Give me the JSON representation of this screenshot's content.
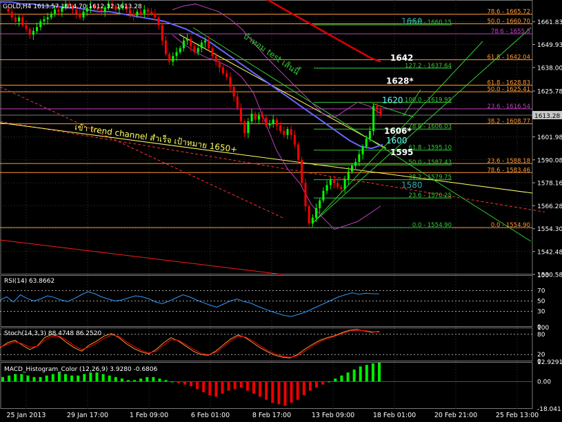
{
  "colors": {
    "background": "#000000",
    "grid": "#3a3a3a",
    "bull_candle": "#00ff00",
    "bear_candle": "#ff0000",
    "price_tag": "#c8c8c8",
    "fib_orange": "#ff9933",
    "fib_violet": "#c040c0",
    "fib_green": "#33cc33",
    "annotation_text": "#ffff66",
    "target_cyan": "#66ffff",
    "ma_fast": "#6666ff",
    "ma_slow": "#dd0000",
    "rsi_line": "#3399ff",
    "stoch_main": "#ff9933",
    "stoch_signal": "#ff0000",
    "macd_pos": "#00ee00",
    "macd_neg": "#ee0000"
  },
  "chart_data": [
    {
      "type": "candlestick",
      "title": "GOLD,H4  1613.57 1614.70 1612.32 1613.28",
      "ylim": [
        1530.58,
        1673.04
      ],
      "yticks": [
        "1661.83",
        "1649.93",
        "1638.00",
        "1625.78",
        "1613.28",
        "1601.98",
        "1590.08",
        "1578.16",
        "1566.28",
        "1554.30",
        "1542.48",
        "1530.58"
      ],
      "current_price": "1613.28",
      "xticks": [
        "25 Jan 2013",
        "29 Jan 17:00",
        "1 Feb 09:00",
        "6 Feb 01:00",
        "8 Feb 17:00",
        "13 Feb 09:00",
        "18 Feb 01:00",
        "20 Feb 21:00",
        "25 Feb 13:00"
      ],
      "fib_levels_right": [
        {
          "label": "78.6 - 1665.72",
          "value": 1665.72,
          "color": "orange"
        },
        {
          "label": "50.0 - 1660.70",
          "value": 1660.7,
          "color": "orange"
        },
        {
          "label": "78.6 - 1655.5",
          "value": 1655.5,
          "color": "violet"
        },
        {
          "label": "61.8 - 1642.04",
          "value": 1642.04,
          "color": "orange"
        },
        {
          "label": "61.8 - 1628.83",
          "value": 1628.83,
          "color": "orange"
        },
        {
          "label": "50.0 - 1625.41",
          "value": 1625.41,
          "color": "orange"
        },
        {
          "label": "23.6 - 1616.54",
          "value": 1616.54,
          "color": "violet"
        },
        {
          "label": "38.2 - 1608.77",
          "value": 1608.77,
          "color": "orange"
        },
        {
          "label": "23.6 - 1588.18",
          "value": 1588.18,
          "color": "orange"
        },
        {
          "label": "78.6 - 1583.46",
          "value": 1583.46,
          "color": "orange"
        },
        {
          "label": "0.0 - 1554.90",
          "value": 1554.9,
          "color": "orange"
        }
      ],
      "fib_levels_mid": [
        {
          "label": "23.6 - 1660.15",
          "value": 1660.15
        },
        {
          "label": "127.2 - 1637.64",
          "value": 1637.64
        },
        {
          "label": "100.0 - 1619.95",
          "value": 1619.95
        },
        {
          "label": "78.6 - 1606.03",
          "value": 1606.03
        },
        {
          "label": "61.8 - 1595.10",
          "value": 1595.1
        },
        {
          "label": "50.0 - 1587.43",
          "value": 1587.43
        },
        {
          "label": "38.2 - 1579.75",
          "value": 1579.75
        },
        {
          "label": "23.6 - 1570.25",
          "value": 1570.25
        },
        {
          "label": "0.0 - 1554.90",
          "value": 1554.9
        }
      ],
      "target_labels": [
        {
          "text": "1660",
          "value": 1662
        },
        {
          "text": "1642",
          "value": 1643
        },
        {
          "text": "1628*",
          "value": 1631
        },
        {
          "text": "1620",
          "value": 1621
        },
        {
          "text": "1606*",
          "value": 1605
        },
        {
          "text": "1600",
          "value": 1600
        },
        {
          "text": "1595",
          "value": 1594
        },
        {
          "text": "1580",
          "value": 1577
        }
      ],
      "annotations": [
        "บ้าทอม test เส้นนี้",
        "เข้า trend channel สำเร็จ เป้าหมาย 1650+"
      ],
      "closes": [
        1667,
        1664,
        1662,
        1664,
        1660,
        1658,
        1655,
        1657,
        1659,
        1662,
        1663,
        1664,
        1666,
        1668,
        1667,
        1669,
        1671,
        1670,
        1668,
        1666,
        1664,
        1667,
        1669,
        1670,
        1669,
        1668,
        1667,
        1669,
        1671,
        1670,
        1668,
        1669,
        1670,
        1668,
        1666,
        1665,
        1667,
        1666,
        1668,
        1667,
        1666,
        1664,
        1660,
        1652,
        1645,
        1641,
        1644,
        1646,
        1648,
        1652,
        1653,
        1649,
        1646,
        1648,
        1651,
        1652,
        1648,
        1644,
        1641,
        1638,
        1635,
        1633,
        1628,
        1623,
        1617,
        1610,
        1604,
        1610,
        1614,
        1611,
        1613,
        1612,
        1608,
        1609,
        1611,
        1608,
        1605,
        1603,
        1606,
        1603,
        1598,
        1590,
        1578,
        1566,
        1557,
        1560,
        1565,
        1569,
        1574,
        1577,
        1580,
        1578,
        1576,
        1575,
        1580,
        1584,
        1587,
        1589,
        1593,
        1597,
        1601,
        1605,
        1618,
        1616,
        1613
      ],
      "ma_fast": [
        1672,
        1672,
        1671,
        1671,
        1670,
        1670,
        1669,
        1669,
        1668,
        1667,
        1667,
        1666,
        1665,
        1664,
        1663,
        1662,
        1660,
        1658,
        1655,
        1652,
        1648,
        1644,
        1640,
        1636,
        1632,
        1628,
        1624,
        1620,
        1616,
        1612,
        1608,
        1604,
        1600,
        1597,
        1596,
        1598
      ],
      "ma_slow": [
        1690,
        1689,
        1688,
        1686,
        1684,
        1682,
        1679,
        1676,
        1673,
        1670,
        1667,
        1664,
        1661,
        1658,
        1655,
        1652,
        1649,
        1646,
        1643,
        1641
      ],
      "bollinger_upper": [
        1668,
        1670,
        1671,
        1669,
        1667,
        1663,
        1658,
        1651,
        1644,
        1638,
        1632,
        1626,
        1620,
        1614,
        1612,
        1616,
        1620,
        1618,
        1614
      ],
      "bollinger_lower": [
        1655,
        1650,
        1646,
        1643,
        1641,
        1638,
        1633,
        1625,
        1610,
        1595,
        1585,
        1578,
        1567,
        1560,
        1554,
        1556,
        1558,
        1562,
        1566
      ]
    },
    {
      "type": "line",
      "title": "RSI(14) 63.8662",
      "ylim": [
        0,
        100
      ],
      "yticks": [
        "100",
        "70",
        "50",
        "30",
        "0"
      ],
      "levels": [
        70,
        50,
        30
      ],
      "values": [
        52,
        58,
        48,
        62,
        55,
        50,
        54,
        60,
        57,
        52,
        49,
        55,
        62,
        68,
        64,
        58,
        54,
        50,
        52,
        56,
        60,
        58,
        54,
        48,
        45,
        50,
        56,
        62,
        58,
        52,
        47,
        42,
        38,
        44,
        50,
        54,
        49,
        46,
        40,
        35,
        30,
        26,
        22,
        20,
        24,
        28,
        34,
        40,
        46,
        52,
        58,
        62,
        66,
        63,
        65,
        64,
        63.87
      ]
    },
    {
      "type": "line",
      "title": "Stoch(14,3,3) 88.4748 86.2520",
      "ylim": [
        0,
        100
      ],
      "yticks": [
        "100",
        "80",
        "20",
        "0"
      ],
      "levels": [
        80,
        20
      ],
      "series": [
        {
          "name": "main",
          "values": [
            40,
            55,
            62,
            48,
            35,
            45,
            70,
            80,
            72,
            55,
            40,
            30,
            48,
            60,
            75,
            82,
            70,
            52,
            38,
            28,
            22,
            35,
            55,
            70,
            60,
            45,
            30,
            20,
            18,
            30,
            48,
            66,
            78,
            70,
            55,
            40,
            28,
            18,
            12,
            10,
            20,
            36,
            50,
            62,
            70,
            76,
            85,
            92,
            94,
            90,
            86,
            88.47
          ]
        },
        {
          "name": "signal",
          "values": [
            42,
            50,
            58,
            52,
            42,
            44,
            62,
            75,
            74,
            62,
            46,
            35,
            42,
            54,
            68,
            78,
            74,
            58,
            44,
            32,
            25,
            30,
            48,
            64,
            62,
            50,
            36,
            24,
            20,
            26,
            42,
            60,
            74,
            72,
            60,
            46,
            32,
            22,
            15,
            12,
            16,
            30,
            45,
            58,
            67,
            74,
            82,
            89,
            92,
            91,
            88,
            86.25
          ]
        }
      ]
    },
    {
      "type": "bar",
      "title": "MACD_Histogram_Color (12,26,9)  3.9280 -0.6806",
      "ylim": [
        -18.041,
        12.9291
      ],
      "yticks": [
        "12.9291",
        "0.00",
        "-18.041"
      ],
      "values": [
        3,
        4,
        5,
        5,
        4,
        3,
        3,
        4,
        5,
        6,
        5,
        4,
        4,
        5,
        6,
        6,
        5,
        4,
        3,
        2,
        1,
        1,
        2,
        3,
        3,
        2,
        1,
        0,
        -1,
        -2,
        -3,
        -5,
        -7,
        -9,
        -10,
        -8,
        -6,
        -5,
        -4,
        -6,
        -8,
        -10,
        -12,
        -14,
        -15,
        -16,
        -14,
        -12,
        -9,
        -6,
        -4,
        -2,
        0,
        2,
        4,
        6,
        8,
        10,
        11,
        12,
        12.5
      ]
    }
  ],
  "dashed_lines": [
    {
      "x1": 0,
      "p1": 1610.0,
      "x2": 790,
      "p2": 1563.0,
      "color": "#ff3333"
    },
    {
      "x1": 0,
      "p1": 1628.0,
      "x2": 410,
      "p2": 1560.0,
      "color": "#ff3333"
    }
  ]
}
